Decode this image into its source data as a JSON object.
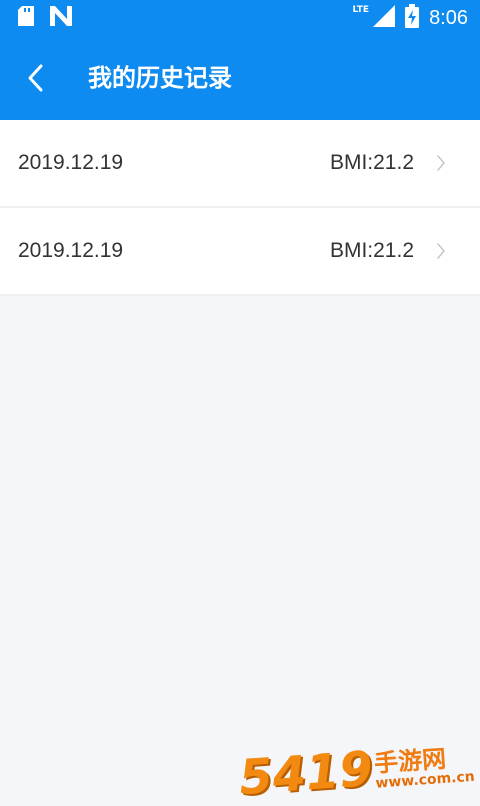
{
  "status_bar": {
    "time": "8:06",
    "network_label": "LTE",
    "icons": [
      "sd-card-icon",
      "n-notification-icon",
      "signal-icon",
      "battery-charging-icon"
    ]
  },
  "app_bar": {
    "title": "我的历史记录",
    "back_icon": "chevron-left-icon"
  },
  "history": [
    {
      "date": "2019.12.19",
      "bmi": "BMI:21.2"
    },
    {
      "date": "2019.12.19",
      "bmi": "BMI:21.2"
    }
  ],
  "watermark": {
    "number": "5419",
    "text_cn": "手游网",
    "url": "www.com.cn"
  },
  "colors": {
    "primary": "#0d8bf0",
    "background": "#f4f6fa",
    "row_background": "#ffffff",
    "chevron": "#c8c8c8",
    "watermark": "#f28a12"
  }
}
